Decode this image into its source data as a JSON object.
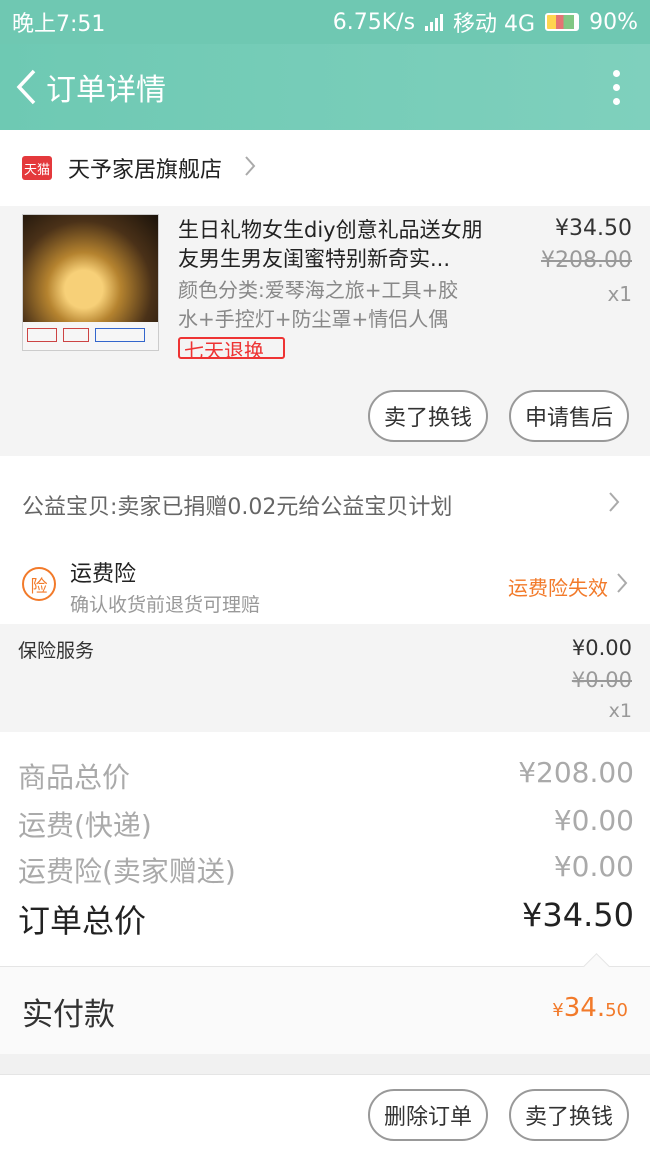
{
  "status_bar": {
    "time": "晚上7:51",
    "speed": "6.75K/s",
    "carrier": "移动 4G",
    "battery": "90%"
  },
  "nav": {
    "title": "订单详情",
    "back_icon": "chevron-left-icon",
    "more_icon": "more-vertical-icon"
  },
  "shop": {
    "badge": "天猫",
    "name": "天予家居旗舰店"
  },
  "item": {
    "title": "生日礼物女生diy创意礼品送女朋友男生男友闺蜜特别新奇实...",
    "spec": "颜色分类:爱琴海之旅+工具+胶水+手控灯+防尘罩+情侣人偶",
    "badge": "七天退换",
    "price": "¥34.50",
    "original_price": "¥208.00",
    "qty": "x1",
    "buttons": {
      "sell": "卖了换钱",
      "after_sale": "申请售后"
    }
  },
  "charity": {
    "text": "公益宝贝:卖家已捐赠0.02元给公益宝贝计划"
  },
  "insurance": {
    "icon_text": "险",
    "title": "运费险",
    "subtitle": "确认收货前退货可理赔",
    "status": "运费险失效"
  },
  "service": {
    "label": "保险服务",
    "price": "¥0.00",
    "original_price": "¥0.00",
    "qty": "x1"
  },
  "totals": {
    "goods_label": "商品总价",
    "goods_value": "¥208.00",
    "shipping_label": "运费(快递)",
    "shipping_value": "¥0.00",
    "insurance_label": "运费险(卖家赠送)",
    "insurance_value": "¥0.00",
    "order_label": "订单总价",
    "order_value": "¥34.50"
  },
  "paid": {
    "label": "实付款",
    "currency": "¥",
    "amount_main": "34.",
    "amount_cents": "50"
  },
  "bottom": {
    "delete": "删除订单",
    "sell": "卖了换钱"
  }
}
